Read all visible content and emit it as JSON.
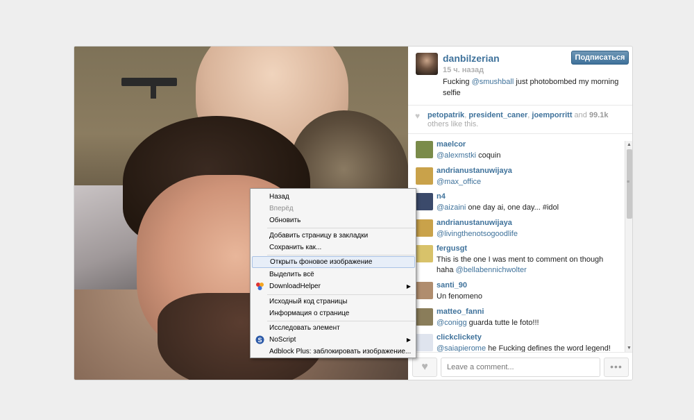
{
  "post": {
    "username": "danbilzerian",
    "time_ago": "15 ч. назад",
    "follow_label": "Подписаться",
    "caption_prefix": "Fucking ",
    "caption_mention": "@smushball",
    "caption_suffix": " just photobombed my morning selfie"
  },
  "likes": {
    "users": [
      "petopatrik",
      "president_caner",
      "joemporritt"
    ],
    "sep1": ", ",
    "sep2": ", ",
    "and": " and ",
    "count": "99.1k",
    "others": " others like this."
  },
  "comments": [
    {
      "user": "maelcor",
      "mention": "@alexmstki",
      "text": " coquin",
      "color": "#7a8b4a"
    },
    {
      "user": "andrianustanuwijaya",
      "mention": "@max_office",
      "text": "",
      "color": "#c9a24a"
    },
    {
      "user": "n4",
      "mention": "@aizaini",
      "text": " one day ai, one day... #idol",
      "color": "#3b4a6b"
    },
    {
      "user": "andrianustanuwijaya",
      "mention": "@livingthenotsogoodlife",
      "text": "",
      "color": "#c9a24a"
    },
    {
      "user": "fergusgt",
      "mention": "",
      "text": "This is the one I was ment to comment on though haha ",
      "mention2": "@bellabennichwolter",
      "color": "#d8c26a"
    },
    {
      "user": "santi_90",
      "mention": "",
      "text": "Un fenomeno",
      "color": "#b08d6e"
    },
    {
      "user": "matteo_fanni",
      "mention": "@conigg",
      "text": " guarda tutte le foto!!!",
      "color": "#8a7d5a"
    },
    {
      "user": "clickclickety",
      "mention": "@saiapierome",
      "text": " he Fucking defines the word legend!",
      "color": "#dfe4ee"
    }
  ],
  "comment_input": {
    "placeholder": "Leave a comment..."
  },
  "more_label": "•••",
  "like_icon": "heart-icon",
  "context_menu": {
    "items": [
      {
        "label": "Назад",
        "disabled": false
      },
      {
        "label": "Вперёд",
        "disabled": true
      },
      {
        "label": "Обновить",
        "disabled": false
      },
      {
        "label": "Добавить страницу в закладки",
        "disabled": false
      },
      {
        "label": "Сохранить как...",
        "disabled": false
      },
      {
        "label": "Открыть фоновое изображение",
        "disabled": false,
        "highlighted": true
      },
      {
        "label": "Выделить всё",
        "disabled": false
      },
      {
        "label": "DownloadHelper",
        "disabled": false,
        "submenu": true,
        "icon": "downloadhelper-icon"
      },
      {
        "label": "Исходный код страницы",
        "disabled": false
      },
      {
        "label": "Информация о странице",
        "disabled": false
      },
      {
        "label": "Исследовать элемент",
        "disabled": false
      },
      {
        "label": "NoScript",
        "disabled": false,
        "submenu": true,
        "icon": "noscript-icon"
      },
      {
        "label": "Adblock Plus: заблокировать изображение...",
        "disabled": false
      }
    ]
  },
  "colors": {
    "link": "#3f729b",
    "button": "#3f729b",
    "background": "#eeeeee"
  }
}
